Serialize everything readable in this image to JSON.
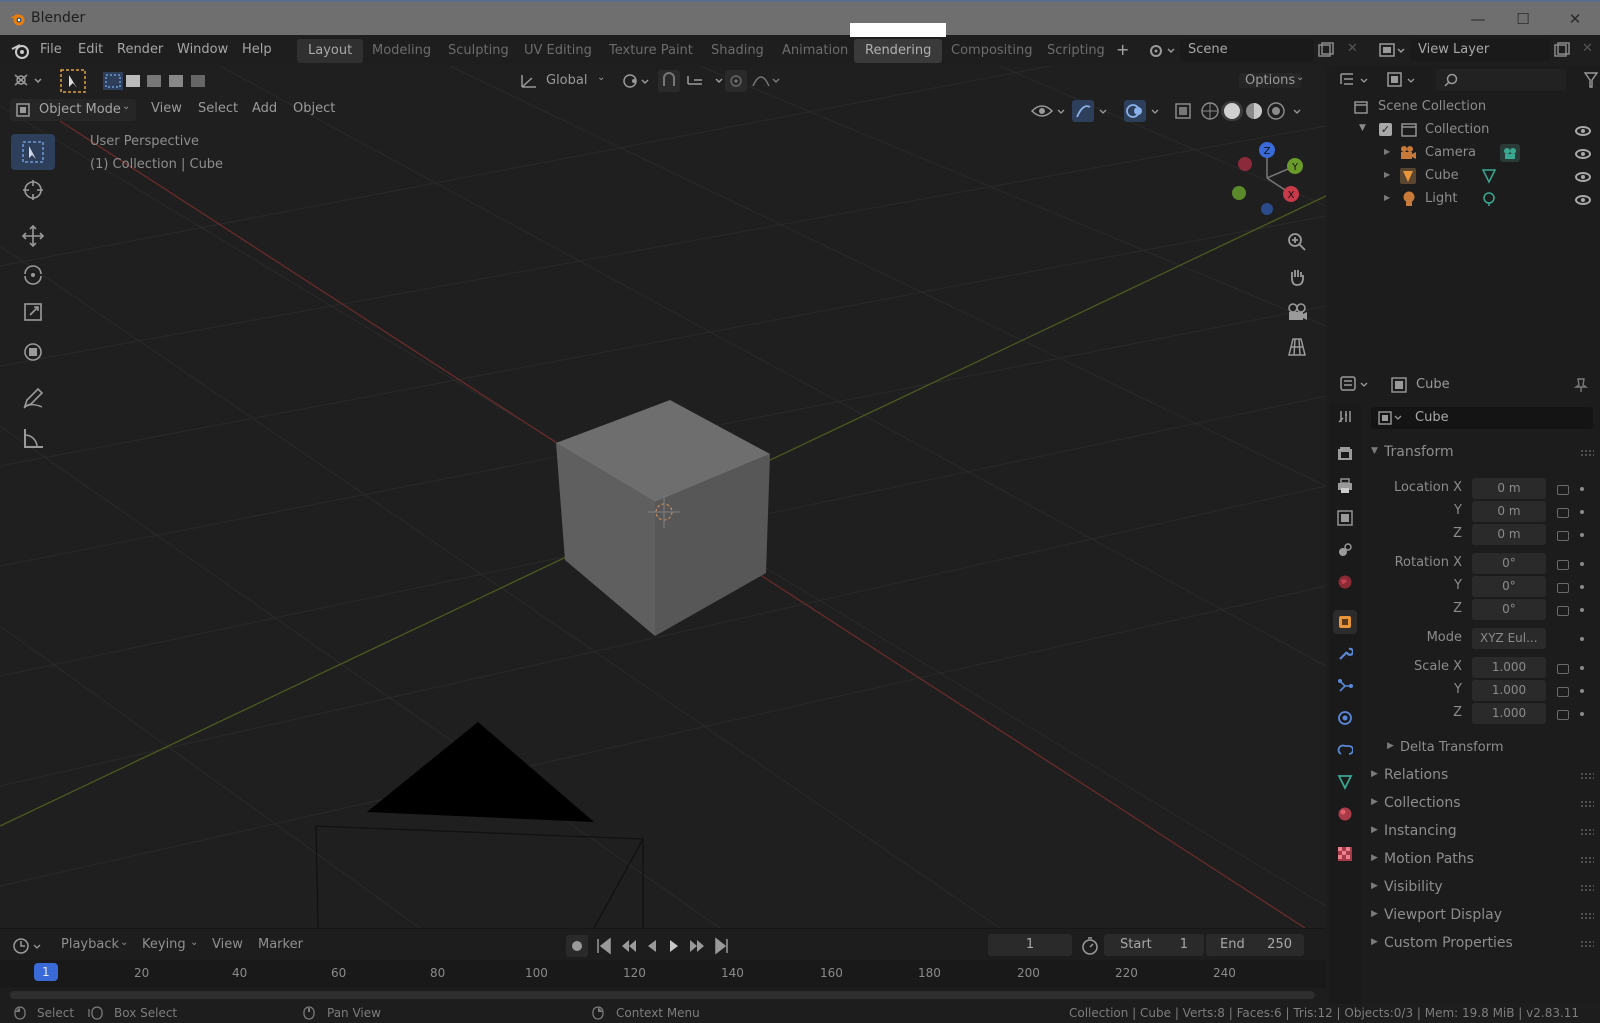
{
  "window": {
    "title": "Blender",
    "minimize": "—",
    "maximize": "☐",
    "close": "✕"
  },
  "menu": [
    "File",
    "Edit",
    "Render",
    "Window",
    "Help"
  ],
  "workspaces": [
    {
      "label": "Layout",
      "state": "active"
    },
    {
      "label": "Modeling",
      "state": ""
    },
    {
      "label": "Sculpting",
      "state": ""
    },
    {
      "label": "UV Editing",
      "state": ""
    },
    {
      "label": "Texture Paint",
      "state": ""
    },
    {
      "label": "Shading",
      "state": ""
    },
    {
      "label": "Animation",
      "state": ""
    },
    {
      "label": "Rendering",
      "state": "hl"
    },
    {
      "label": "Compositing",
      "state": ""
    },
    {
      "label": "Scripting",
      "state": ""
    }
  ],
  "add_workspace": "+",
  "scene": {
    "label": "Scene"
  },
  "view_layer": {
    "label": "View Layer"
  },
  "viewport": {
    "orientation": "Global",
    "options": "Options",
    "mode": "Object Mode",
    "menus": [
      "View",
      "Select",
      "Add",
      "Object"
    ],
    "perspective": "User Perspective",
    "context": "(1) Collection | Cube",
    "gizmo": {
      "x": "X",
      "y": "Y",
      "z": "Z"
    }
  },
  "outliner": {
    "search_placeholder": "",
    "scene_collection": "Scene Collection",
    "collection": "Collection",
    "items": [
      "Camera",
      "Cube",
      "Light"
    ]
  },
  "properties": {
    "object_name": "Cube",
    "name_field": "Cube",
    "transform_panel": "Transform",
    "location": {
      "label": "Location X",
      "x": "0 m",
      "y": "0 m",
      "z": "0 m"
    },
    "rotation": {
      "label": "Rotation X",
      "x": "0°",
      "y": "0°",
      "z": "0°"
    },
    "mode": {
      "label": "Mode",
      "value": "XYZ Eul..."
    },
    "scale": {
      "label": "Scale X",
      "x": "1.000",
      "y": "1.000",
      "z": "1.000"
    },
    "axis_labels": {
      "y": "Y",
      "z": "Z"
    },
    "delta": "Delta Transform",
    "panels": [
      "Relations",
      "Collections",
      "Instancing",
      "Motion Paths",
      "Visibility",
      "Viewport Display",
      "Custom Properties"
    ]
  },
  "timeline": {
    "menus": [
      "Playback",
      "Keying",
      "View",
      "Marker"
    ],
    "current_frame": "1",
    "start_label": "Start",
    "start": "1",
    "end_label": "End",
    "end": "250",
    "ruler": [
      "1",
      "20",
      "40",
      "60",
      "80",
      "100",
      "120",
      "140",
      "160",
      "180",
      "200",
      "220",
      "240"
    ]
  },
  "status": {
    "select": "Select",
    "box_select": "Box Select",
    "pan_view": "Pan View",
    "context_menu": "Context Menu",
    "stats": "Collection | Cube | Verts:8 | Faces:6 | Tris:12 | Objects:0/3 | Mem: 19.8 MiB | v2.83.11"
  }
}
